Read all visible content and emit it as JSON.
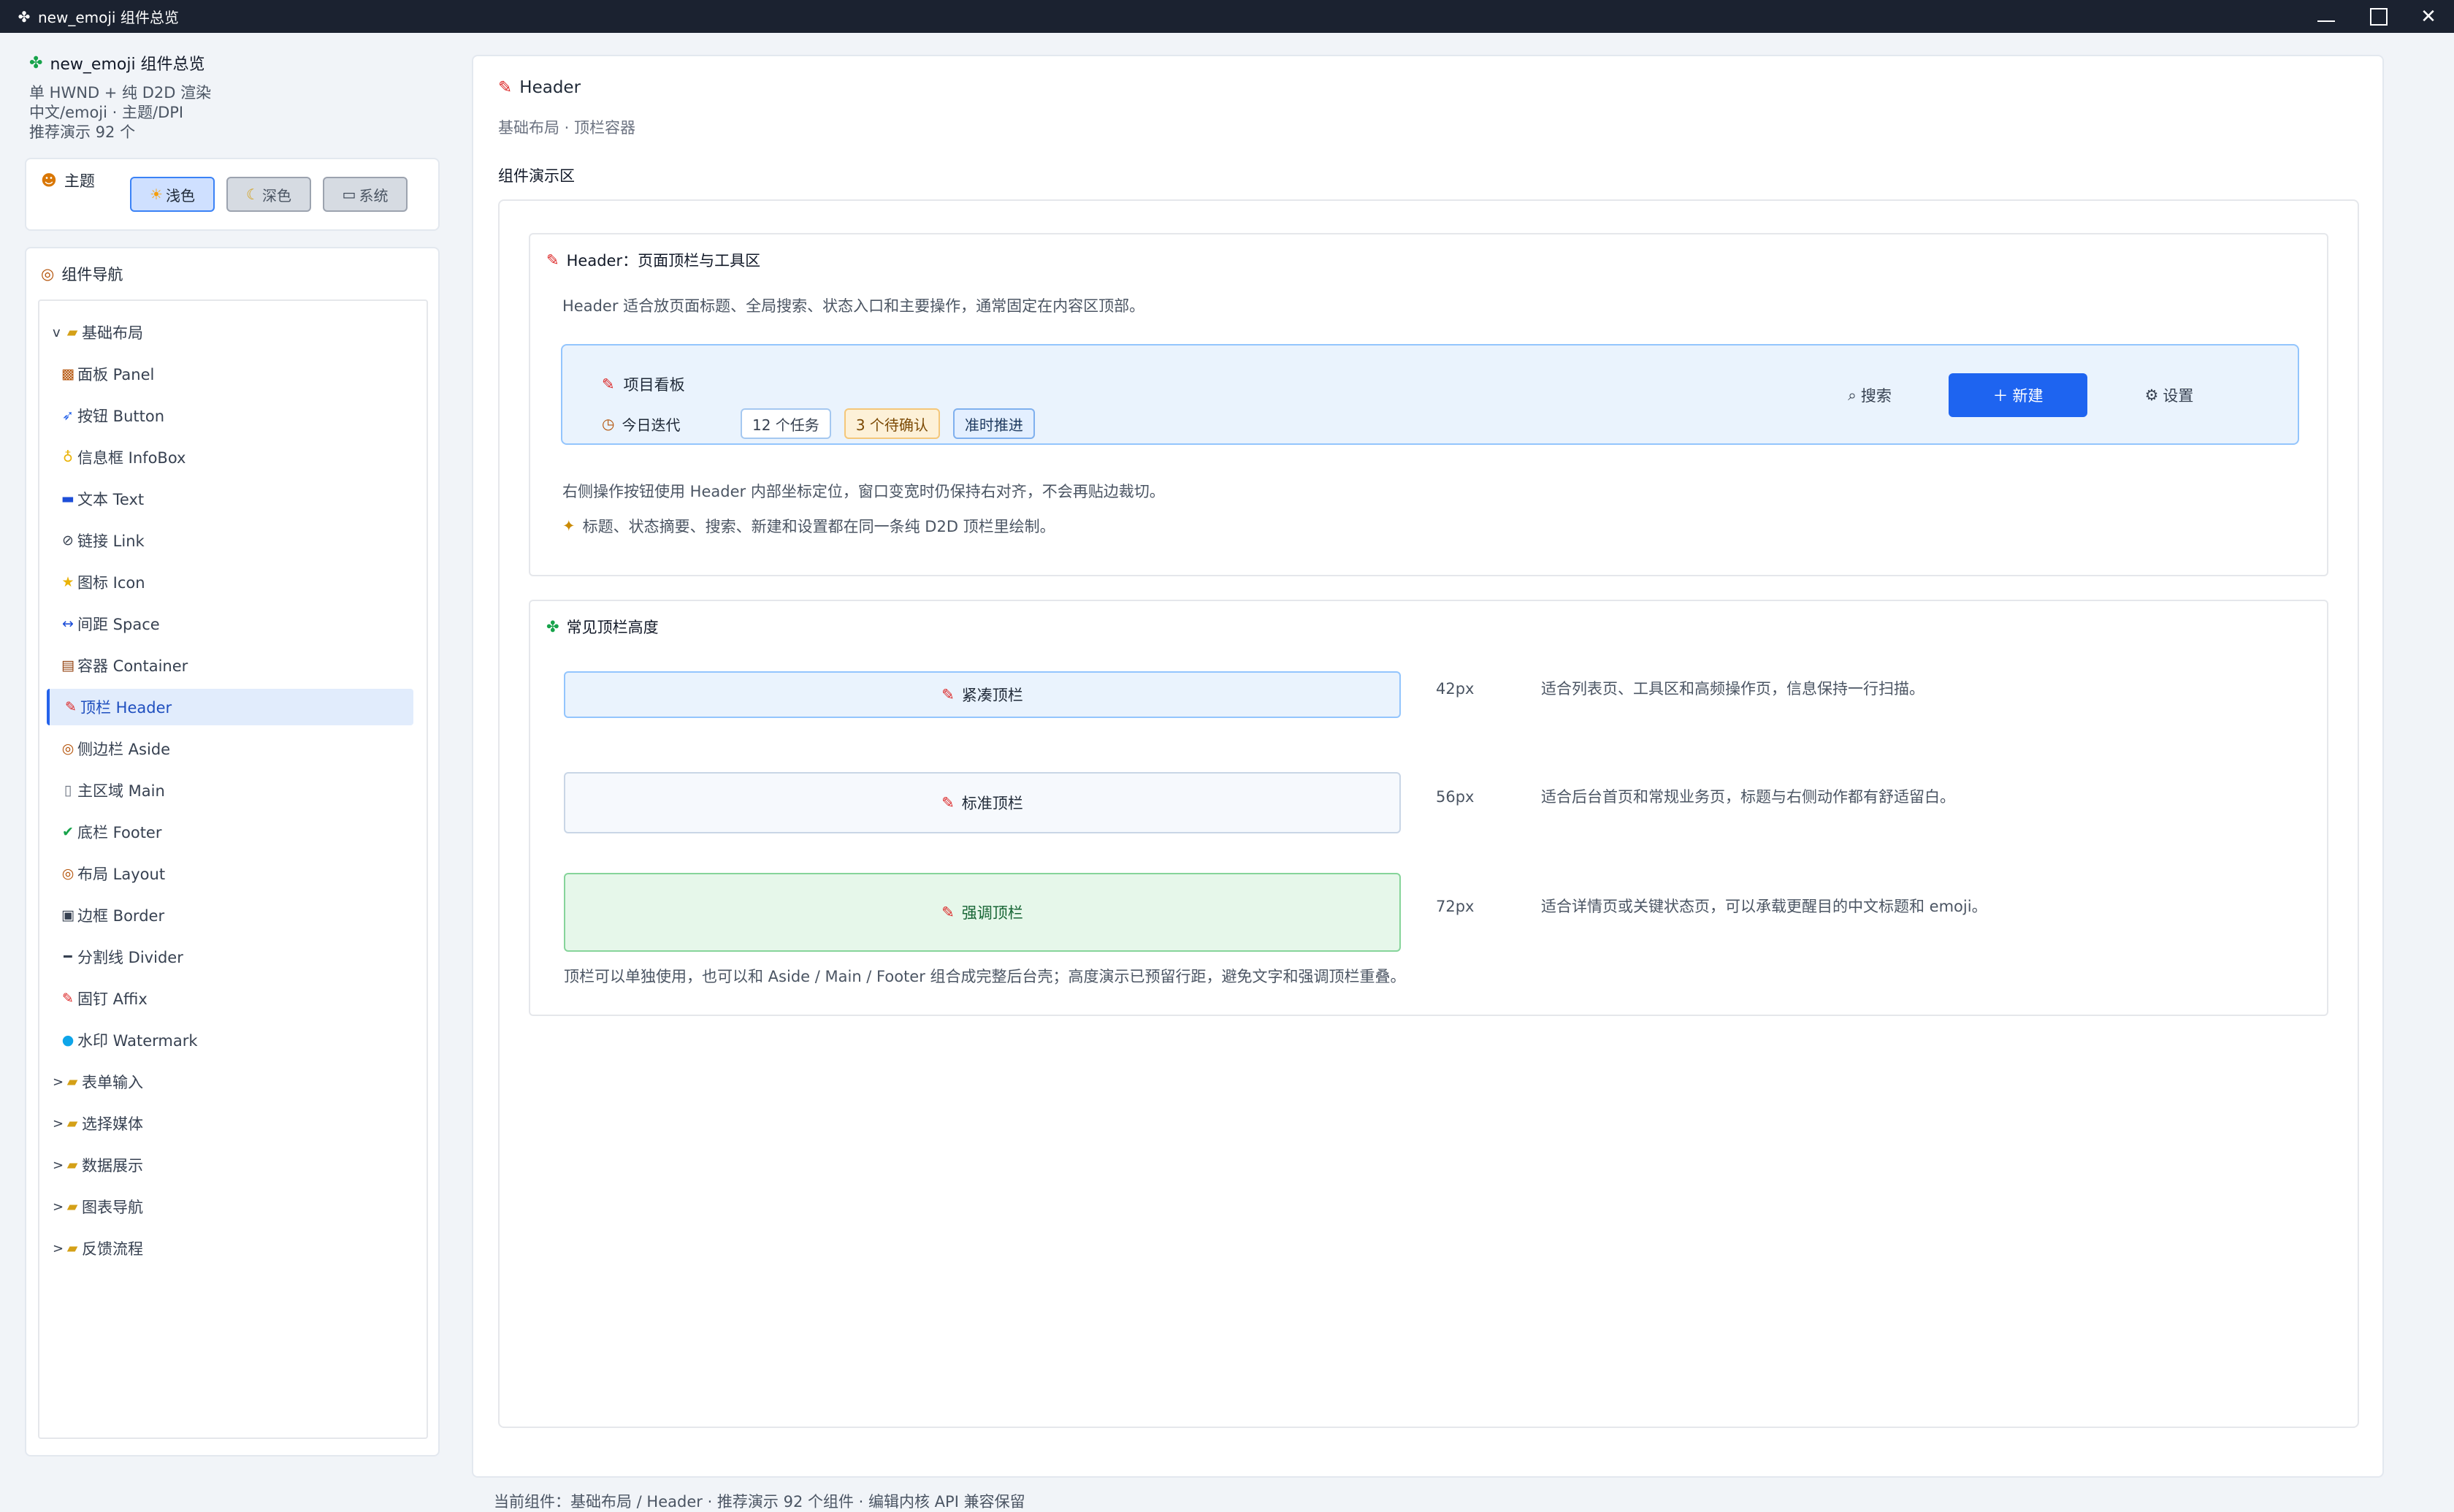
{
  "window": {
    "icon": "puzzle-icon",
    "title": "new_emoji 组件总览",
    "controls": [
      "minimize",
      "maximize",
      "close"
    ]
  },
  "app": {
    "icon": "puzzle-icon",
    "name": "new_emoji 组件总览",
    "desc_lines": [
      "单 HWND + 纯 D2D 渲染",
      "中文/emoji · 主题/DPI",
      "推荐演示 92 个"
    ]
  },
  "theme": {
    "icon": "palette-icon",
    "label": "主题",
    "options": [
      {
        "icon": "sun-icon",
        "label": "浅色",
        "active": true
      },
      {
        "icon": "moon-icon",
        "label": "深色",
        "active": false
      },
      {
        "icon": "laptop-icon",
        "label": "系统",
        "active": false
      }
    ]
  },
  "nav": {
    "icon": "compass-icon",
    "label": "组件导航",
    "items": [
      {
        "kind": "group",
        "chevron": "v",
        "icon": "folder-icon",
        "label": "基础布局"
      },
      {
        "kind": "child",
        "icon": "panel-icon",
        "label": "面板 Panel"
      },
      {
        "kind": "child",
        "icon": "button-icon",
        "label": "按钮 Button"
      },
      {
        "kind": "child",
        "icon": "bulb-icon",
        "label": "信息框 InfoBox"
      },
      {
        "kind": "child",
        "icon": "text-icon",
        "label": "文本 Text"
      },
      {
        "kind": "child",
        "icon": "link-icon",
        "label": "链接 Link"
      },
      {
        "kind": "child",
        "icon": "star-icon",
        "label": "图标 Icon"
      },
      {
        "kind": "child",
        "icon": "space-icon",
        "label": "间距 Space"
      },
      {
        "kind": "child",
        "icon": "container-icon",
        "label": "容器 Container"
      },
      {
        "kind": "child",
        "icon": "pin-icon",
        "label": "顶栏 Header",
        "active": true
      },
      {
        "kind": "child",
        "icon": "compass-icon",
        "label": "侧边栏 Aside"
      },
      {
        "kind": "child",
        "icon": "page-icon",
        "label": "主区域 Main"
      },
      {
        "kind": "child",
        "icon": "check-icon",
        "label": "底栏 Footer"
      },
      {
        "kind": "child",
        "icon": "compass-icon",
        "label": "布局 Layout"
      },
      {
        "kind": "child",
        "icon": "border-icon",
        "label": "边框 Border"
      },
      {
        "kind": "child",
        "icon": "divider-icon",
        "label": "分割线 Divider"
      },
      {
        "kind": "child",
        "icon": "pin-icon",
        "label": "固钉 Affix"
      },
      {
        "kind": "child",
        "icon": "drop-icon",
        "label": "水印 Watermark"
      },
      {
        "kind": "group",
        "chevron": ">",
        "icon": "folder-icon",
        "label": "表单输入"
      },
      {
        "kind": "group",
        "chevron": ">",
        "icon": "folder-icon",
        "label": "选择媒体"
      },
      {
        "kind": "group",
        "chevron": ">",
        "icon": "folder-icon",
        "label": "数据展示"
      },
      {
        "kind": "group",
        "chevron": ">",
        "icon": "folder-icon",
        "label": "图表导航"
      },
      {
        "kind": "group",
        "chevron": ">",
        "icon": "folder-icon",
        "label": "反馈流程"
      }
    ]
  },
  "main": {
    "icon": "pin-icon",
    "title": "Header",
    "subtitle": "基础布局 · 顶栏容器",
    "demo_label": "组件演示区",
    "section1": {
      "icon": "pin-icon",
      "title": "Header：页面顶栏与工具区",
      "desc": "Header 适合放页面标题、全局搜索、状态入口和主要操作，通常固定在内容区顶部。",
      "demo": {
        "title_icon": "pin-icon",
        "title": "项目看板",
        "iter_icon": "clock-icon",
        "iter_label": "今日迭代",
        "chips": [
          {
            "label": "12 个任务",
            "style": "normal"
          },
          {
            "label": "3 个待确认",
            "style": "warn"
          },
          {
            "label": "准时推进",
            "style": "info"
          }
        ],
        "search": {
          "icon": "search-icon",
          "label": "搜索"
        },
        "new": {
          "icon": "plus-icon",
          "label": "新建"
        },
        "settings": {
          "icon": "gear-icon",
          "label": "设置"
        }
      },
      "note1": "右侧操作按钮使用 Header 内部坐标定位，窗口变宽时仍保持右对齐，不会再贴边裁切。",
      "note2_icon": "sparkle-icon",
      "note2": "标题、状态摘要、搜索、新建和设置都在同一条纯 D2D 顶栏里绘制。"
    },
    "section2": {
      "icon": "puzzle-icon",
      "title": "常见顶栏高度",
      "rows": [
        {
          "icon": "pin-icon",
          "label": "紧凑顶栏",
          "px": "42px",
          "desc": "适合列表页、工具区和高频操作页，信息保持一行扫描。",
          "style": "compact"
        },
        {
          "icon": "pin-icon",
          "label": "标准顶栏",
          "px": "56px",
          "desc": "适合后台首页和常规业务页，标题与右侧动作都有舒适留白。",
          "style": "standard"
        },
        {
          "icon": "pin-icon",
          "label": "强调顶栏",
          "px": "72px",
          "desc": "适合详情页或关键状态页，可以承载更醒目的中文标题和 emoji。",
          "style": "emphasis"
        }
      ],
      "foot": "顶栏可以单独使用，也可以和 Aside / Main / Footer 组合成完整后台壳；高度演示已预留行距，避免文字和强调顶栏重叠。"
    }
  },
  "status_bar": "当前组件：基础布局 / Header · 推荐演示 92 个组件 · 编辑内核 API 兼容保留"
}
